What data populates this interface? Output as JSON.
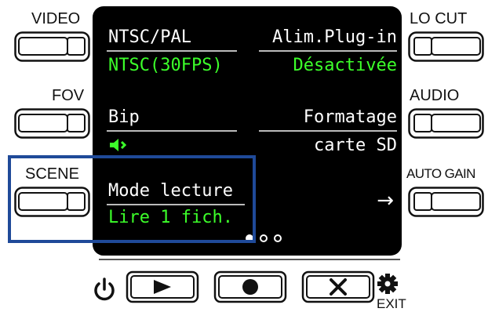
{
  "left_buttons": [
    {
      "label": "VIDEO"
    },
    {
      "label": "FOV"
    },
    {
      "label": "SCENE"
    }
  ],
  "right_buttons": [
    {
      "label": "LO CUT"
    },
    {
      "label": "AUDIO"
    },
    {
      "label": "AUTO GAIN"
    }
  ],
  "screen": {
    "items": [
      {
        "title": "NTSC/PAL",
        "value": "NTSC(30FPS)"
      },
      {
        "title": "Alim.Plug-in",
        "value": "Désactivée"
      },
      {
        "title": "Bip",
        "value_icon": "speaker-on-icon"
      },
      {
        "title": "Formatage",
        "value": "carte SD"
      },
      {
        "title": "Mode lecture",
        "value": "Lire 1 fich."
      }
    ],
    "next_arrow": "→",
    "page_indicator": {
      "pages": 3,
      "current": 1
    }
  },
  "bottom_buttons": [
    {
      "name": "play",
      "icon": "play-icon"
    },
    {
      "name": "record",
      "icon": "record-icon"
    },
    {
      "name": "cancel",
      "icon": "close-icon"
    }
  ],
  "power_icon": "power-icon",
  "settings": {
    "icon": "gear-icon",
    "label": "EXIT"
  },
  "colors": {
    "screen_bg": "#000000",
    "title_text": "#ffffff",
    "value_text": "#3cff2a",
    "highlight_frame": "#1f4a99"
  }
}
